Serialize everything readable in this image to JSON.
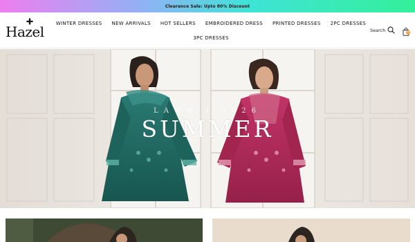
{
  "announcement": {
    "text": "Clearance Sale: Upto 80% Discount"
  },
  "brand": {
    "logo_text": "Hazel"
  },
  "nav": {
    "row1": [
      "WINTER DRESSES",
      "NEW ARRIVALS",
      "HOT SELLERS",
      "EMBROIDERED DRESS",
      "PRINTED DRESSES",
      "2PC DRESSES"
    ],
    "row2": [
      "3PC DRESSES"
    ]
  },
  "header": {
    "search_label": "Search",
    "cart_count": "0"
  },
  "hero": {
    "kicker": "LAWN / 2026",
    "title": "SUMMER"
  },
  "colors": {
    "accent": "#f2a23a",
    "hero_green": "#1f6a64",
    "hero_magenta": "#b02a5c"
  }
}
